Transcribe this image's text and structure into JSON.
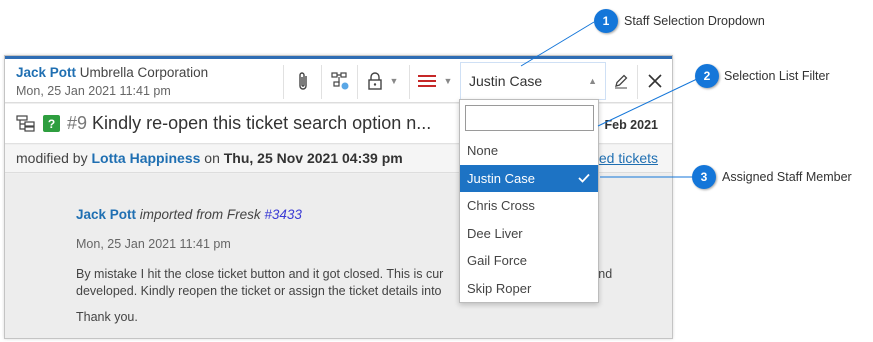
{
  "ticket": {
    "sender_name": "Jack Pott",
    "sender_org": "Umbrella Corporation",
    "sender_date": "Mon, 25 Jan 2021 11:41 pm",
    "staff_selected": "Justin Case",
    "number": "#9",
    "title": "Kindly re-open this ticket search option n...",
    "title_date": "Feb 2021",
    "modified_prefix": "modified by",
    "modified_by": "Lotta Happiness",
    "modified_on_label": "on",
    "modified_date": "Thu, 25 Nov 2021 04:39 pm",
    "linked_link": "ked tickets"
  },
  "message": {
    "author": "Jack Pott",
    "imported_from": "imported from Fresk",
    "ref": "#3433",
    "date": "Mon, 25 Jan 2021 11:41 pm",
    "para1": "By mistake I hit the close ticket button and it got closed. This is cur",
    "para1_tail": "and",
    "para2": "developed. Kindly reopen the ticket or assign the ticket details into",
    "thanks": "Thank you."
  },
  "dropdown": {
    "filter_value": "",
    "options": [
      "None",
      "Justin Case",
      "Chris Cross",
      "Dee Liver",
      "Gail Force",
      "Skip Roper"
    ],
    "selected_index": 1
  },
  "callouts": [
    {
      "num": "1",
      "label": "Staff Selection Dropdown"
    },
    {
      "num": "2",
      "label": "Selection List Filter"
    },
    {
      "num": "3",
      "label": "Assigned Staff Member"
    }
  ],
  "colors": {
    "accent": "#1f6fb2",
    "selected_bg": "#1d73c4",
    "callout": "#1476d9",
    "badge_green": "#2e9e3f",
    "priority_red": "#c62828"
  },
  "icons": {
    "attach": "paperclip-icon",
    "workflow": "workflow-icon",
    "lock": "lock-icon",
    "priority": "priority-lines-icon",
    "edit": "pencil-icon",
    "close": "close-icon",
    "tree": "tree-icon",
    "check": "check-icon"
  }
}
